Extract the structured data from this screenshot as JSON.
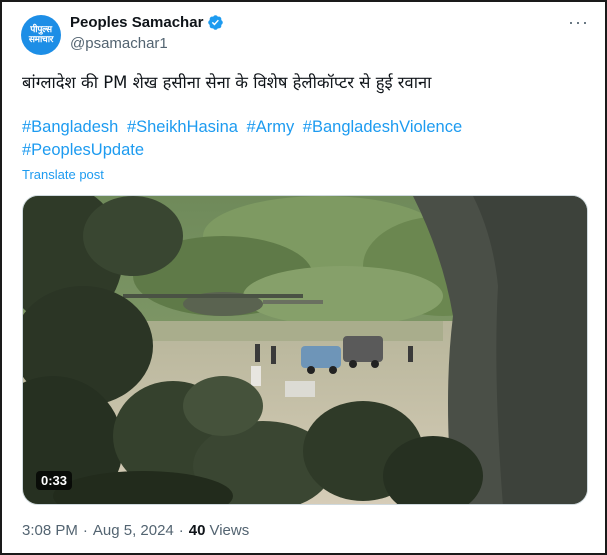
{
  "account": {
    "avatar_text_line1": "पीपुल्स",
    "avatar_text_line2": "समाचार",
    "name": "Peoples Samachar",
    "handle": "@psamachar1",
    "verified_color": "#1d9bf0"
  },
  "menu": {
    "more_label": "···"
  },
  "tweet": {
    "text": "बांग्लादेश की PM शेख हसीना सेना के विशेष हेलीकॉप्टर से हुई रवाना",
    "hashtags": [
      "#Bangladesh",
      "#SheikhHasina",
      "#Army",
      "#BangladeshViolence",
      "#PeoplesUpdate"
    ],
    "translate_label": "Translate post"
  },
  "media": {
    "duration": "0:33"
  },
  "meta": {
    "time": "3:08 PM",
    "date": "Aug 5, 2024",
    "views_count": "40",
    "views_label": "Views"
  },
  "colors": {
    "link": "#1d9bf0",
    "muted": "#536471",
    "text": "#0f1419"
  }
}
